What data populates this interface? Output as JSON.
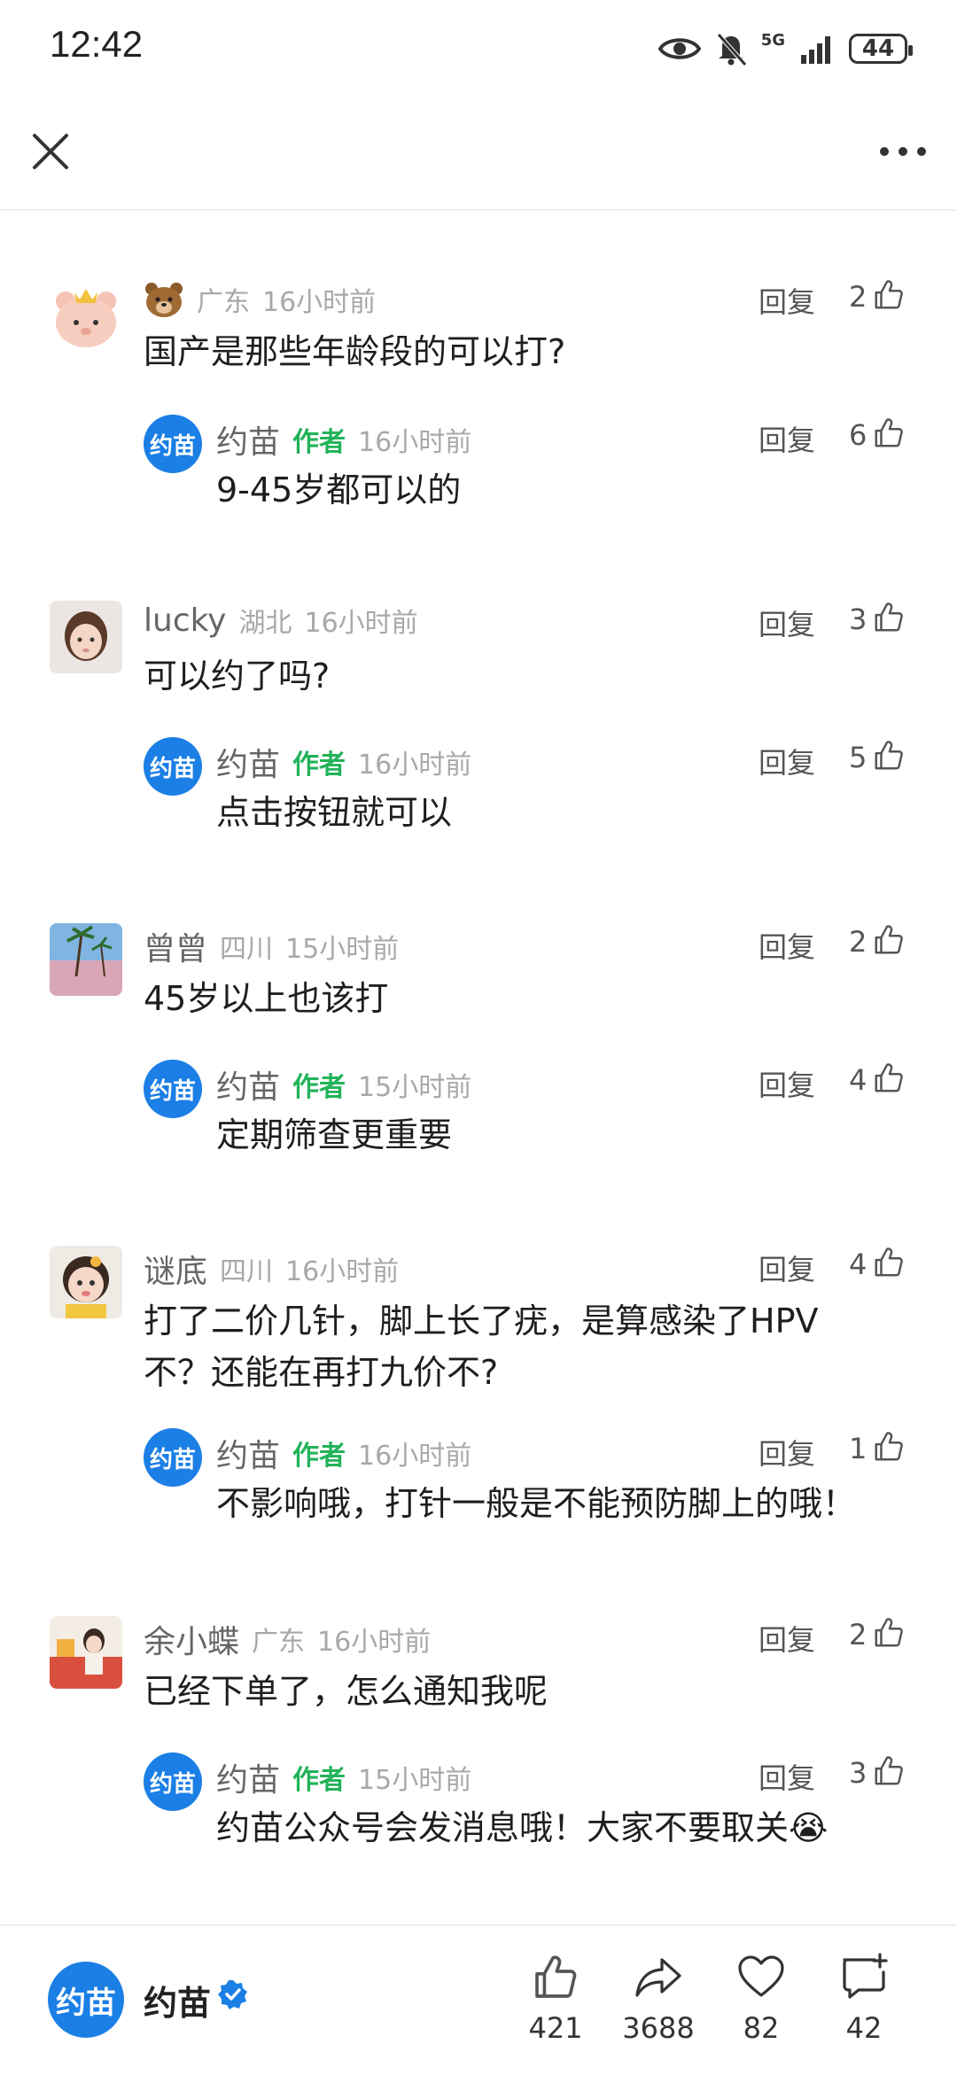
{
  "status_bar": {
    "time": "12:42",
    "battery": "44",
    "network": "5G"
  },
  "comments": [
    {
      "user": "",
      "location": "广东",
      "time": "16小时前",
      "text": "国产是那些年龄段的可以打?",
      "likes": "2",
      "reply_label": "回复",
      "reply": {
        "user": "约苗",
        "author_tag": "作者",
        "time": "16小时前",
        "text": "9-45岁都可以的",
        "likes": "6",
        "reply_label": "回复"
      }
    },
    {
      "user": "lucky",
      "location": "湖北",
      "time": "16小时前",
      "text": "可以约了吗?",
      "likes": "3",
      "reply_label": "回复",
      "reply": {
        "user": "约苗",
        "author_tag": "作者",
        "time": "16小时前",
        "text": "点击按钮就可以",
        "likes": "5",
        "reply_label": "回复"
      }
    },
    {
      "user": "曾曾",
      "location": "四川",
      "time": "15小时前",
      "text": "45岁以上也该打",
      "likes": "2",
      "reply_label": "回复",
      "reply": {
        "user": "约苗",
        "author_tag": "作者",
        "time": "15小时前",
        "text": "定期筛查更重要",
        "likes": "4",
        "reply_label": "回复"
      }
    },
    {
      "user": "谜底",
      "location": "四川",
      "time": "16小时前",
      "text": "打了二价几针，脚上长了疣，是算感染了HPV 不？还能在再打九价不?",
      "likes": "4",
      "reply_label": "回复",
      "reply": {
        "user": "约苗",
        "author_tag": "作者",
        "time": "16小时前",
        "text": "不影响哦，打针一般是不能预防脚上的哦！",
        "likes": "1",
        "reply_label": "回复"
      }
    },
    {
      "user": "余小蝶",
      "location": "广东",
      "time": "16小时前",
      "text": "已经下单了，怎么通知我呢",
      "likes": "2",
      "reply_label": "回复",
      "reply": {
        "user": "约苗",
        "author_tag": "作者",
        "time": "15小时前",
        "text": "约苗公众号会发消息哦！大家不要取关😭",
        "likes": "3",
        "reply_label": "回复"
      }
    }
  ],
  "reply_avatar_text": "约苗",
  "bottom_bar": {
    "brand_avatar_text": "约苗",
    "brand_name": "约苗",
    "likes": "421",
    "shares": "3688",
    "favorites": "82",
    "comments": "42"
  },
  "colors": {
    "brand_blue": "#1b7fe6",
    "author_green": "#22b359"
  }
}
